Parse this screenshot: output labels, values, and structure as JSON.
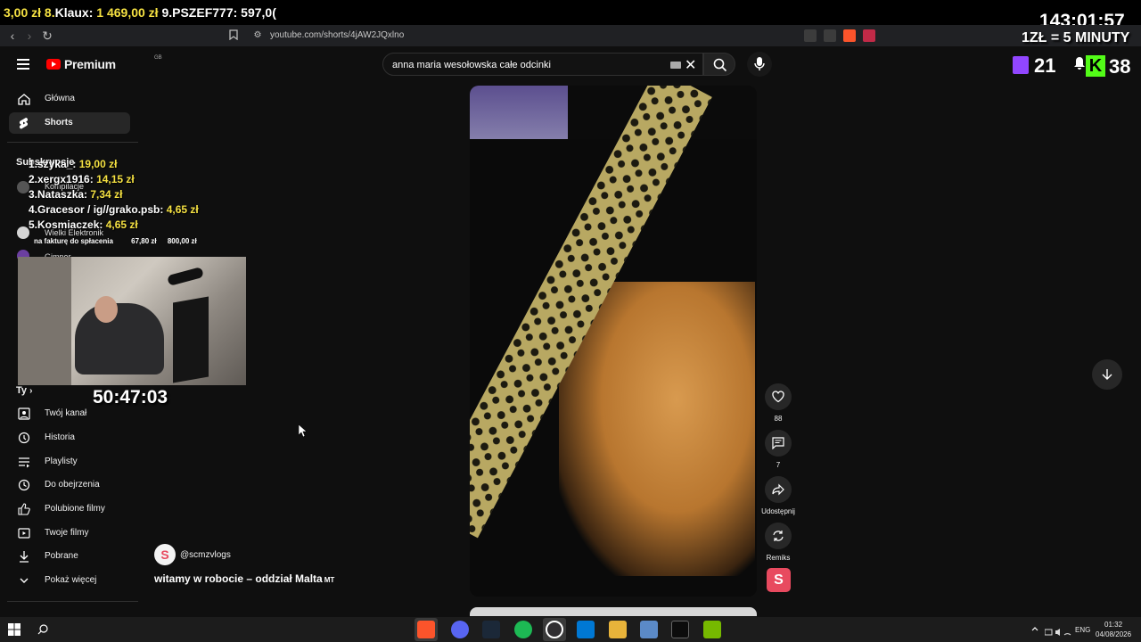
{
  "ticker": {
    "prefix": "3,00 zł 8.",
    "items": [
      {
        "name": "Klaux: ",
        "amount": "1 469,00 zł"
      },
      {
        "name": " 9.PSZEF777: ",
        "amount": "597,0("
      }
    ]
  },
  "browser": {
    "url": "youtube.com/shorts/4jAW2JQxlno"
  },
  "overlay": {
    "top_timer": "143:01:57",
    "rate": "1ZŁ = 5 MINUTY",
    "twitch_viewers": "21",
    "kick_viewers": "38",
    "kick_letter": "K",
    "stream_timer": "50:47:03"
  },
  "header": {
    "logo_text": "Premium",
    "logo_region": "GB",
    "search_value": "anna maria wesołowska całe odcinki"
  },
  "sidebar": {
    "top": [
      {
        "label": "Główna"
      },
      {
        "label": "Shorts"
      }
    ],
    "subs_head": "Subskrypcje",
    "subs": [
      {
        "label": "Kompilacje"
      },
      {
        "label": "Wielki Elektronik"
      },
      {
        "label": "Gimper"
      }
    ],
    "you_head": "Ty",
    "you": [
      {
        "label": "Twój kanał"
      },
      {
        "label": "Historia"
      },
      {
        "label": "Playlisty"
      },
      {
        "label": "Do obejrzenia"
      },
      {
        "label": "Polubione filmy"
      },
      {
        "label": "Twoje filmy"
      },
      {
        "label": "Pobrane"
      },
      {
        "label": "Pokaż więcej"
      }
    ]
  },
  "donors": [
    {
      "name": "1.szyka_: ",
      "amount": "19,00 zł"
    },
    {
      "name": "2.xergx1916: ",
      "amount": "14,15 zł"
    },
    {
      "name": "3.Nataszka: ",
      "amount": "7,34 zł"
    },
    {
      "name": "4.Gracesor / ig//grako.psb: ",
      "amount": "4,65 zł"
    },
    {
      "name": "5.Kosmiaczek: ",
      "amount": "4,65 zł"
    }
  ],
  "goal": {
    "label": "na fakturę do spłacenia",
    "current": "67,80 zł",
    "target": "800,00 zł"
  },
  "short": {
    "likes": "88",
    "comments": "7",
    "share_label": "Udostępnij",
    "remix_label": "Remiks",
    "channel": "@scmzvlogs",
    "title": "witamy w robocie – oddział Malta",
    "title_suffix": "MT",
    "badge_letter": "S"
  },
  "taskbar": {
    "lang": "ENG",
    "time": "01:32",
    "date": "04/08/2026"
  },
  "colors": {
    "accent_red": "#ff0000",
    "amount_yellow": "#f5e142",
    "twitch": "#9146ff",
    "kick": "#53fc18"
  }
}
